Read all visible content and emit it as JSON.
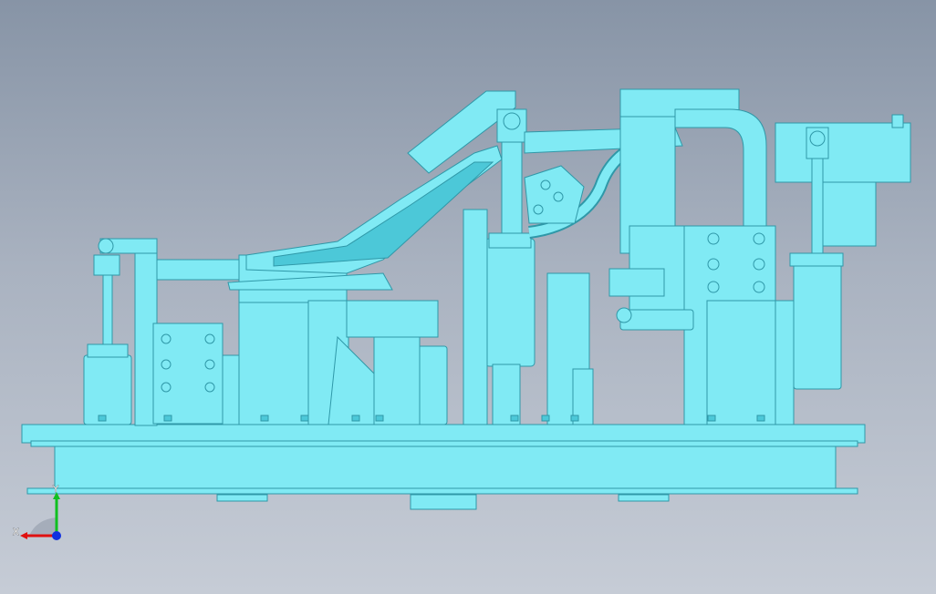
{
  "viewport": {
    "background_top": "#8794a6",
    "background_bottom": "#c6ccd6",
    "model_fill": "#80eaf4",
    "model_stroke": "#2f98a8",
    "model_dark": "#4cc8d8"
  },
  "triad": {
    "x_label": "X",
    "y_label": "Y",
    "x_color": "#e01010",
    "y_color": "#10c020",
    "z_color": "#1030e0"
  }
}
